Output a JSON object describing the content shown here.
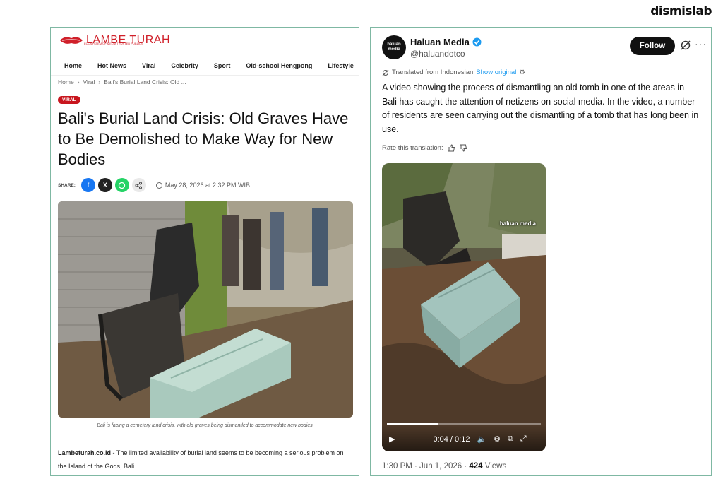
{
  "brand": "dismislab",
  "article": {
    "logo": "LAMBE TURAH",
    "logo_tagline": "ECOSYSTEM OF MEDIA TRUSTED PUBLICS",
    "nav": [
      "Home",
      "Hot News",
      "Viral",
      "Celebrity",
      "Sport",
      "Old-school Hengpong",
      "Lifestyle"
    ],
    "breadcrumb": [
      "Home",
      "Viral",
      "Bali's Burial Land Crisis: Old ..."
    ],
    "badge": "VIRAL",
    "headline": "Bali's Burial Land Crisis: Old Graves Have to Be Demolished to Make Way for New Bodies",
    "share_label": "SHARE:",
    "share_buttons": [
      {
        "icon": "facebook-icon",
        "glyph": "f",
        "color": "#1877f2"
      },
      {
        "icon": "x-icon",
        "glyph": "X",
        "color": "#222222"
      },
      {
        "icon": "whatsapp-icon",
        "glyph": "◯",
        "color": "#25d366"
      },
      {
        "icon": "share-icon",
        "glyph": "⋖",
        "color": "#e9e9e9"
      }
    ],
    "date": "May 28, 2026 at 2:32 PM WIB",
    "caption": "Bali is facing a cemetery land crisis, with old graves being dismantled to accommodate new bodies.",
    "lead_source": "Lambeturah.co.id",
    "lead_text": " - The limited availability of burial land seems to be becoming a serious problem on the Island of the Gods, Bali."
  },
  "tweet": {
    "name": "Haluan Media",
    "handle": "@haluandotco",
    "avatar_text": "haluan media",
    "follow_label": "Follow",
    "translated_label": "Translated from Indonesian",
    "show_original": "Show original",
    "text": "A video showing the process of dismantling an old tomb in one of the areas in Bali has caught the attention of netizens on social media. In the video, a number of residents are seen carrying out the dismantling of a tomb that has long been in use.",
    "rate_label": "Rate this translation:",
    "video_watermark": "haluan media",
    "video_time": "0:04 / 0:12",
    "video_progress": 0.33,
    "meta_prefix": "1:30 PM · Jun 1, 2026 · ",
    "views_count": "424",
    "views_label": " Views"
  }
}
